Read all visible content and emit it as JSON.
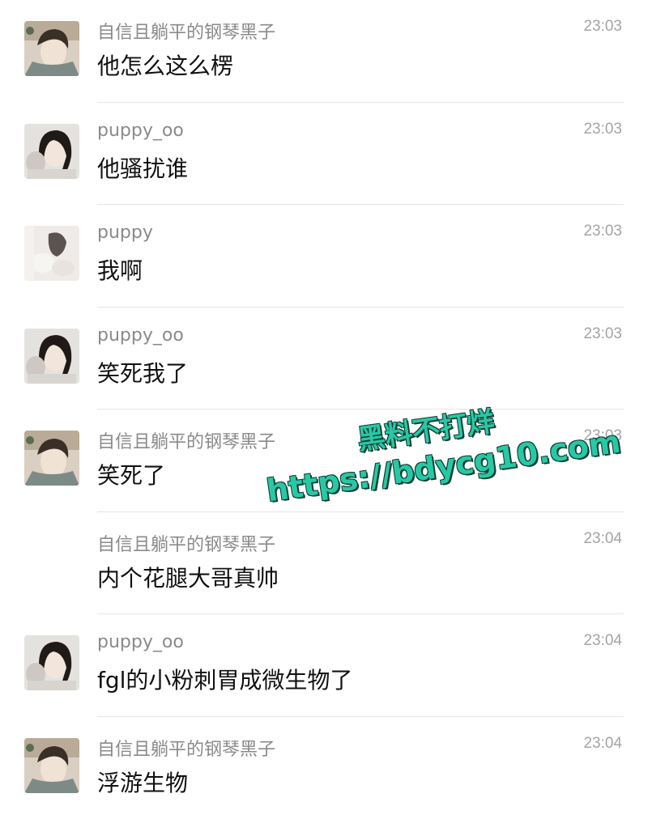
{
  "messages": [
    {
      "name": "自信且躺平的钢琴黑子",
      "text": "他怎么这么楞",
      "time": "23:03",
      "avatar": "avatar-a"
    },
    {
      "name": "puppy_oo",
      "text": "他骚扰谁",
      "time": "23:03",
      "avatar": "avatar-b"
    },
    {
      "name": "puppy",
      "text": "我啊",
      "time": "23:03",
      "avatar": "avatar-c"
    },
    {
      "name": "puppy_oo",
      "text": "笑死我了",
      "time": "23:03",
      "avatar": "avatar-b"
    },
    {
      "name": "自信且躺平的钢琴黑子",
      "text": "笑死了",
      "time": "23:03",
      "avatar": "avatar-a"
    },
    {
      "name": "自信且躺平的钢琴黑子",
      "text": "内个花腿大哥真帅",
      "time": "23:04",
      "avatar": "none"
    },
    {
      "name": "puppy_oo",
      "text": "fgl的小粉刺胃成微生物了",
      "time": "23:04",
      "avatar": "avatar-b"
    },
    {
      "name": "自信且躺平的钢琴黑子",
      "text": "浮游生物",
      "time": "23:04",
      "avatar": "avatar-a"
    }
  ],
  "watermark": {
    "line1": "黑料不打烊",
    "line1b": "bdycg10.com",
    "line2": "https://bdycg10.com",
    "color": "#27c9a5"
  }
}
